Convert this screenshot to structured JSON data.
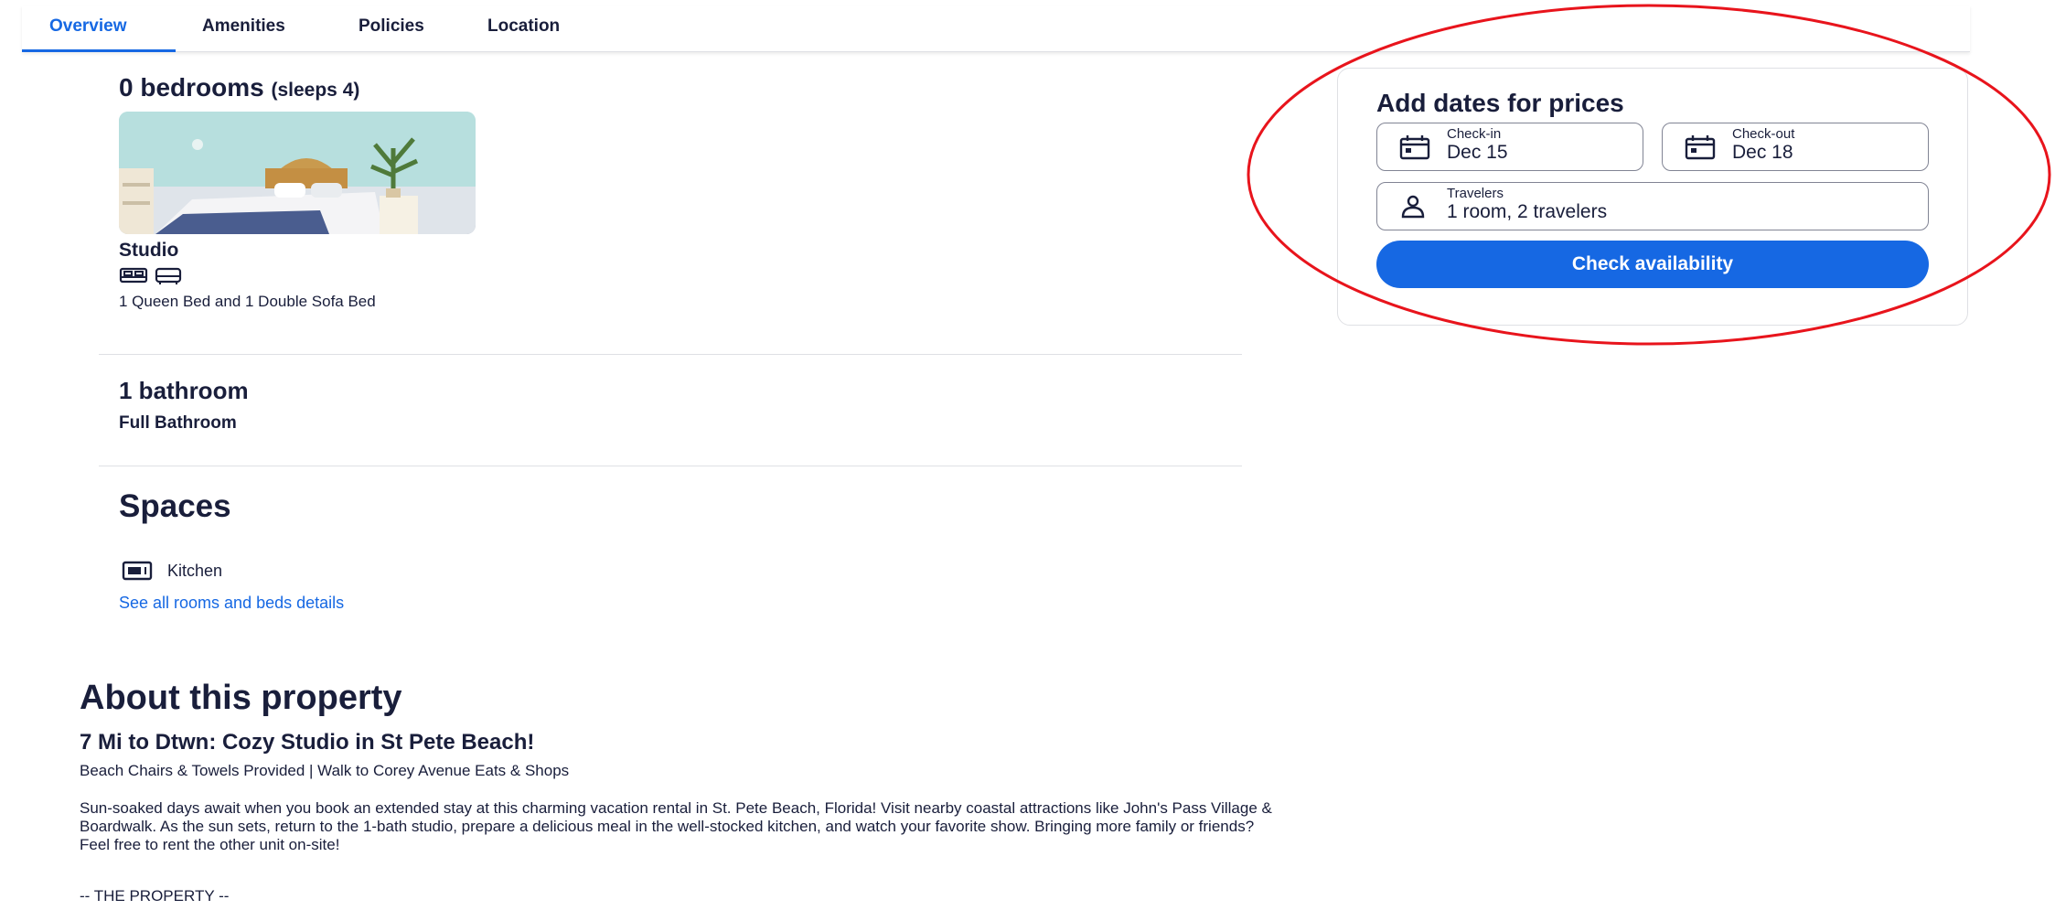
{
  "tabs": [
    {
      "label": "Overview",
      "active": true
    },
    {
      "label": "Amenities",
      "active": false
    },
    {
      "label": "Policies",
      "active": false
    },
    {
      "label": "Location",
      "active": false
    }
  ],
  "rooms": {
    "heading": "0 bedrooms",
    "sleeps": "(sleeps 4)",
    "studio_label": "Studio",
    "bed_icons": [
      "bed-icon",
      "sofa-bed-icon"
    ],
    "bed_description": "1 Queen Bed and 1 Double Sofa Bed"
  },
  "bathroom": {
    "heading": "1 bathroom",
    "description": "Full Bathroom"
  },
  "spaces": {
    "heading": "Spaces",
    "kitchen_label": "Kitchen",
    "see_all_link": "See all rooms and beds details"
  },
  "about": {
    "heading": "About this property",
    "title": "7 Mi to Dtwn: Cozy Studio in St Pete Beach!",
    "tagline": "Beach Chairs & Towels Provided | Walk to Corey Avenue Eats & Shops",
    "description": "Sun-soaked days await when you book an extended stay at this charming vacation rental in St. Pete Beach, Florida! Visit nearby coastal attractions like John's Pass Village & Boardwalk. As the sun sets, return to the 1-bath studio, prepare a delicious meal in the well-stocked kitchen, and watch your favorite show. Bringing more family or friends? Feel free to rent the other unit on-site!",
    "section_heading": "-- THE PROPERTY --"
  },
  "booking": {
    "title": "Add dates for prices",
    "checkin_label": "Check-in",
    "checkin_value": "Dec 15",
    "checkout_label": "Check-out",
    "checkout_value": "Dec 18",
    "travelers_label": "Travelers",
    "travelers_value": "1 room, 2 travelers",
    "button_label": "Check availability"
  },
  "colors": {
    "accent": "#1668e3",
    "text": "#191e3b",
    "annotation": "#e8141c"
  }
}
